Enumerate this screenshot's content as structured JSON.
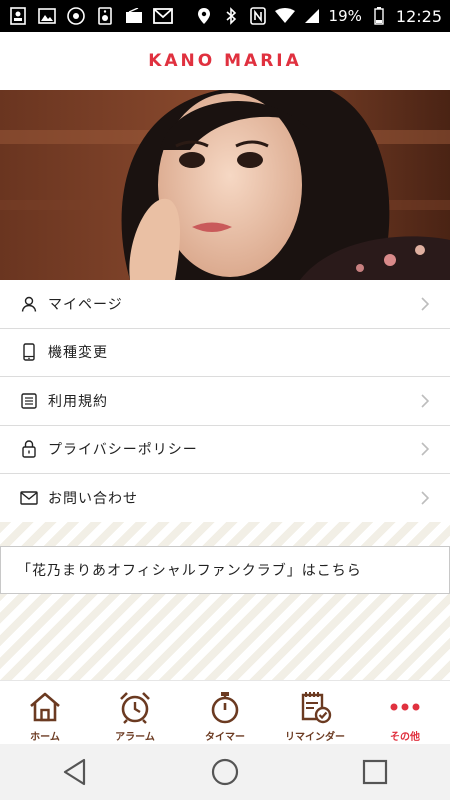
{
  "status_bar": {
    "battery": "19%",
    "time": "12:25",
    "icons": [
      "contacts-icon",
      "gallery-icon",
      "chrome-icon",
      "speaker-icon",
      "radio-icon",
      "gmail-icon",
      "location-icon",
      "bluetooth-icon",
      "nfc-icon",
      "wifi-icon",
      "signal-icon",
      "battery-icon"
    ]
  },
  "header": {
    "logo": "KANO MARIA"
  },
  "menu": {
    "items": [
      {
        "label": "マイページ",
        "icon": "person-icon",
        "chevron": true
      },
      {
        "label": "機種変更",
        "icon": "phone-icon",
        "chevron": false
      },
      {
        "label": "利用規約",
        "icon": "document-icon",
        "chevron": true
      },
      {
        "label": "プライバシーポリシー",
        "icon": "lock-icon",
        "chevron": true
      },
      {
        "label": "お問い合わせ",
        "icon": "mail-icon",
        "chevron": true
      }
    ]
  },
  "banner": {
    "text": "「花乃まりあオフィシャルファンクラブ」はこちら"
  },
  "tabbar": {
    "tabs": [
      {
        "label": "ホーム",
        "icon": "home-icon",
        "active": false
      },
      {
        "label": "アラーム",
        "icon": "alarm-clock-icon",
        "active": false
      },
      {
        "label": "タイマー",
        "icon": "stopwatch-icon",
        "active": false
      },
      {
        "label": "リマインダー",
        "icon": "reminder-note-icon",
        "active": false
      },
      {
        "label": "その他",
        "icon": "more-dots-icon",
        "active": true
      }
    ]
  },
  "colors": {
    "accent": "#e0313f",
    "tab_brown": "#6b3a21",
    "stripe": "#f2efe6"
  }
}
